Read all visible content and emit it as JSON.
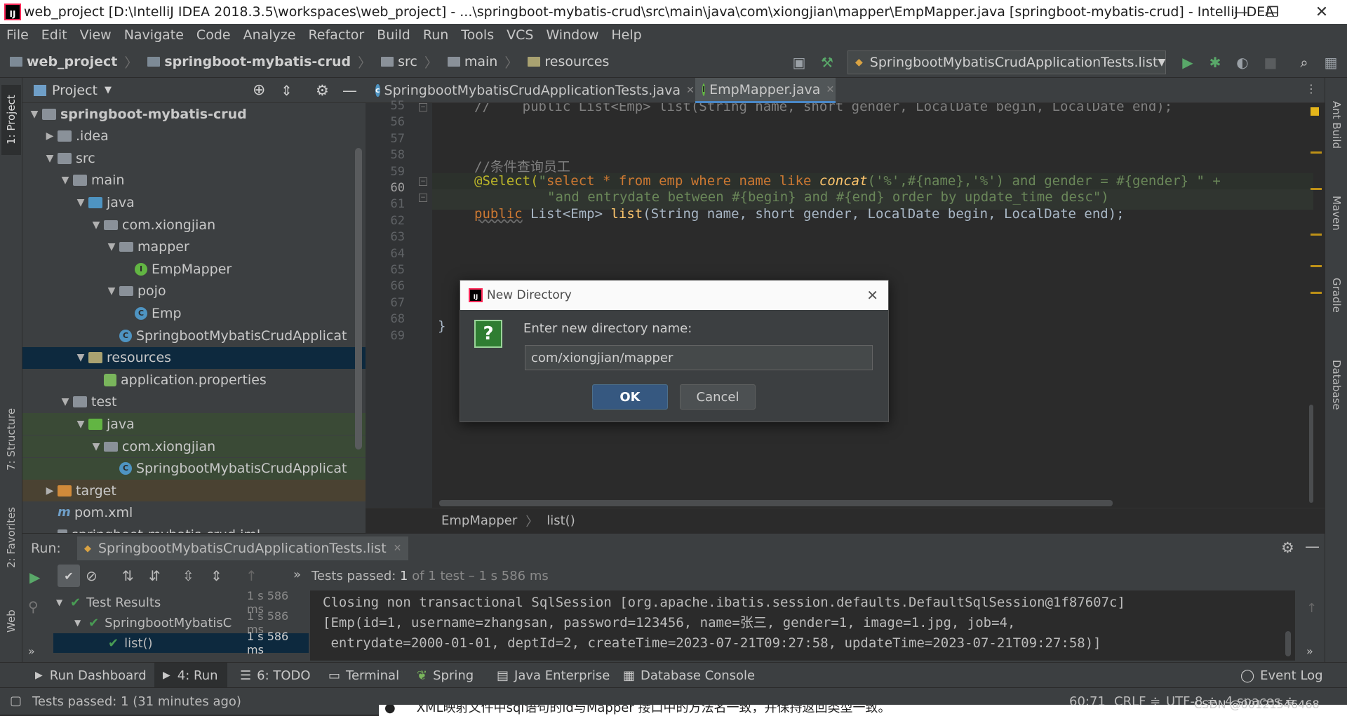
{
  "window": {
    "title": "web_project [D:\\IntelliJ IDEA 2018.3.5\\workspaces\\web_project] - ...\\springboot-mybatis-crud\\src\\main\\java\\com\\xiongjian\\mapper\\EmpMapper.java [springboot-mybatis-crud] - IntelliJ IDEA",
    "logo": "IJ",
    "controls": {
      "minimize": "—",
      "restore": "❐",
      "close": "✕"
    }
  },
  "menu": [
    "File",
    "Edit",
    "View",
    "Navigate",
    "Code",
    "Analyze",
    "Refactor",
    "Build",
    "Run",
    "Tools",
    "VCS",
    "Window",
    "Help"
  ],
  "nav": {
    "crumbs": [
      "web_project",
      "springboot-mybatis-crud",
      "src",
      "main",
      "resources"
    ],
    "run_config": "SpringbootMybatisCrudApplicationTests.list"
  },
  "left_strip": {
    "project": "1: Project",
    "structure": "7: Structure",
    "favorites": "2: Favorites",
    "web": "Web"
  },
  "right_strip": {
    "ant": "Ant Build",
    "maven": "Maven",
    "gradle": "Gradle",
    "database": "Database"
  },
  "project_panel": {
    "title": "Project",
    "tree": [
      {
        "label": "springboot-mybatis-crud",
        "depth": 0,
        "arrow": "▼",
        "icon": "folder"
      },
      {
        "label": ".idea",
        "depth": 1,
        "arrow": "▶",
        "icon": "folder"
      },
      {
        "label": "src",
        "depth": 1,
        "arrow": "▼",
        "icon": "folder"
      },
      {
        "label": "main",
        "depth": 2,
        "arrow": "▼",
        "icon": "folder"
      },
      {
        "label": "java",
        "depth": 3,
        "arrow": "▼",
        "icon": "folder-blue"
      },
      {
        "label": "com.xiongjian",
        "depth": 4,
        "arrow": "▼",
        "icon": "package"
      },
      {
        "label": "mapper",
        "depth": 5,
        "arrow": "▼",
        "icon": "package"
      },
      {
        "label": "EmpMapper",
        "depth": 6,
        "arrow": "",
        "icon": "interface"
      },
      {
        "label": "pojo",
        "depth": 5,
        "arrow": "▼",
        "icon": "package"
      },
      {
        "label": "Emp",
        "depth": 6,
        "arrow": "",
        "icon": "class"
      },
      {
        "label": "SpringbootMybatisCrudApplicat",
        "depth": 5,
        "arrow": "",
        "icon": "spring-class"
      },
      {
        "label": "resources",
        "depth": 3,
        "arrow": "▼",
        "icon": "folder-res",
        "selected": true
      },
      {
        "label": "application.properties",
        "depth": 4,
        "arrow": "",
        "icon": "properties"
      },
      {
        "label": "test",
        "depth": 2,
        "arrow": "▼",
        "icon": "folder"
      },
      {
        "label": "java",
        "depth": 3,
        "arrow": "▼",
        "icon": "folder-green",
        "test": true
      },
      {
        "label": "com.xiongjian",
        "depth": 4,
        "arrow": "▼",
        "icon": "package",
        "test": true
      },
      {
        "label": "SpringbootMybatisCrudApplicat",
        "depth": 5,
        "arrow": "",
        "icon": "spring-class",
        "test": true
      },
      {
        "label": "target",
        "depth": 1,
        "arrow": "▶",
        "icon": "folder-orange",
        "excluded": true
      },
      {
        "label": "pom.xml",
        "depth": 1,
        "arrow": "",
        "icon": "maven"
      },
      {
        "label": "springboot-mybatis-crud.iml",
        "depth": 1,
        "arrow": "",
        "icon": "file"
      }
    ]
  },
  "editor": {
    "tabs": [
      {
        "label": "SpringbootMybatisCrudApplicationTests.java",
        "active": false
      },
      {
        "label": "EmpMapper.java",
        "active": true
      }
    ],
    "line_numbers": [
      "55",
      "56",
      "57",
      "58",
      "59",
      "60",
      "61",
      "62",
      "63",
      "64",
      "65",
      "66",
      "67",
      "68",
      "69"
    ],
    "current_line": "60",
    "breadcrumb": [
      "EmpMapper",
      "list()"
    ],
    "code": {
      "l55": "//    public List<Emp> list(String name, short gender, LocalDate begin, LocalDate end);",
      "l58": "//条件查询员工",
      "l59_ann": "@Select(",
      "l59_q1": "\"",
      "l59_sql": "select * from emp where name like ",
      "l59_fn": "concat",
      "l59_rest": "('%',#{name},'%') and gender = #{gender} \" +",
      "l60": "\"and entrydate between #{begin} and #{end} order by update_time desc\")",
      "l61_pub": "public",
      "l61_rest": " List<Emp> ",
      "l61_fn": "list",
      "l61_args": "(String name, short gender, LocalDate begin, LocalDate end);",
      "l66": "}"
    }
  },
  "dialog": {
    "title": "New Directory",
    "prompt": "Enter new directory name:",
    "value": "com/xiongjian/mapper",
    "ok": "OK",
    "cancel": "Cancel",
    "q_icon": "?"
  },
  "run": {
    "label": "Run:",
    "config_tab": "SpringbootMybatisCrudApplicationTests.list",
    "status_prefix": "Tests passed: ",
    "status_count": "1",
    "status_suffix": " of 1 test – 1 s 586 ms",
    "tree": [
      {
        "label": "Test Results",
        "time": "1 s 586 ms"
      },
      {
        "label": "SpringbootMybatisC",
        "time": "1 s 586 ms"
      },
      {
        "label": "list()",
        "time": "1 s 586 ms"
      }
    ],
    "console": [
      "Closing non transactional SqlSession [org.apache.ibatis.session.defaults.DefaultSqlSession@1f87607c]",
      "[Emp(id=1, username=zhangsan, password=123456, name=张三, gender=1, image=1.jpg, job=4,",
      " entrydate=2000-01-01, deptId=2, createTime=2023-07-21T09:27:58, updateTime=2023-07-21T09:27:58)]"
    ]
  },
  "bottom_tabs": {
    "run_dashboard": "Run Dashboard",
    "run": "4: Run",
    "todo": "6: TODO",
    "terminal": "Terminal",
    "spring": "Spring",
    "java_enterprise": "Java Enterprise",
    "database_console": "Database Console",
    "event_log": "Event Log"
  },
  "status": {
    "message": "Tests passed: 1 (31 minutes ago)",
    "position": "60:71",
    "line_sep": "CRLF ≑",
    "encoding": "UTF-8 ≑",
    "indent": "4 spaces ≑",
    "overlay": "XML映射文件中sql语句的id与Mapper 接口中的方法名一致，并保持返回类型一致。",
    "watermark": "CSDN @00121546468"
  },
  "colors": {
    "accent": "#365880",
    "test_green": "#499c54",
    "selected_row": "#0d293e"
  }
}
